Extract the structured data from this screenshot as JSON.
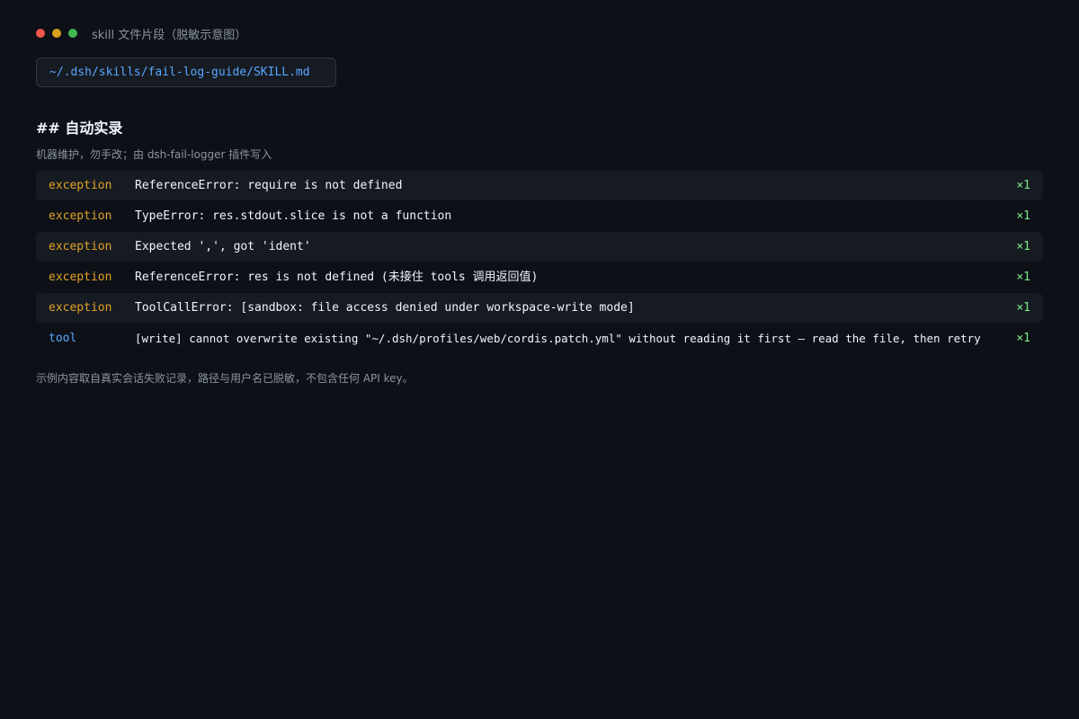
{
  "window": {
    "title": "skill 文件片段（脱敏示意图）"
  },
  "file": {
    "path": "~/.dsh/skills/fail-log-guide/SKILL.md"
  },
  "section": {
    "heading": "## 自动实录",
    "note": "机器维护，勿手改；由 dsh-fail-logger 插件写入"
  },
  "log_entries": [
    {
      "kind": "exception",
      "message": "ReferenceError: require is not defined",
      "count": "×1"
    },
    {
      "kind": "exception",
      "message": "TypeError: res.stdout.slice is not a function",
      "count": "×1"
    },
    {
      "kind": "exception",
      "message": "Expected ',', got 'ident'",
      "count": "×1"
    },
    {
      "kind": "exception",
      "message": "ReferenceError: res is not defined (未接住 tools 调用返回值)",
      "count": "×1"
    },
    {
      "kind": "exception",
      "message": "ToolCallError: [sandbox: file access denied under workspace-write mode]",
      "count": "×1"
    },
    {
      "kind": "tool",
      "message": "[write] cannot overwrite existing \"~/.dsh/profiles/web/cordis.patch.yml\" without reading it first — read the file, then retry",
      "count": "×1"
    }
  ],
  "footer": {
    "note": "示例内容取自真实会话失败记录，路径与用户名已脱敏，不包含任何 API key。"
  },
  "colors": {
    "background": "#0d1117",
    "exception": "#e3a127",
    "tool": "#58a6ff",
    "count": "#7ee787",
    "path": "#58a6ff"
  }
}
